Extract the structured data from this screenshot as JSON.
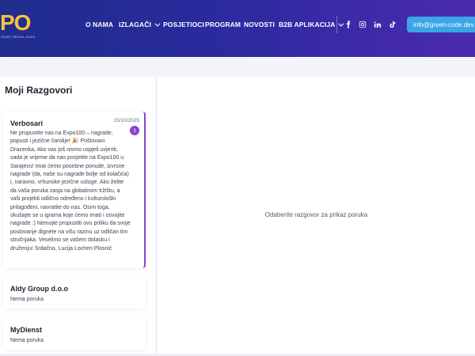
{
  "brand": {
    "logo_text": "PO",
    "logo_sub": "SVIJET, REGIJA, KUĆA"
  },
  "nav": {
    "items": [
      {
        "label": "O NAMA",
        "has_dropdown": false
      },
      {
        "label": "IZLAGAČI",
        "has_dropdown": true
      },
      {
        "label": "POSJETIOCI",
        "has_dropdown": false
      },
      {
        "label": "PROGRAM",
        "has_dropdown": false
      },
      {
        "label": "NOVOSTI",
        "has_dropdown": false
      },
      {
        "label": "B2B APLIKACIJA",
        "has_dropdown": true
      }
    ]
  },
  "social": [
    "facebook-icon",
    "instagram-icon",
    "linkedin-icon",
    "tiktok-icon"
  ],
  "user": {
    "email": "info@green-code.dev"
  },
  "left_panel": {
    "title": "Moji Razgovori",
    "conversations": [
      {
        "name": "Verbosari",
        "date": "15/10/2025",
        "unread": "2",
        "message": "Ne propustite nas na Expo100 – nagrade, popusti i jezične čarolije! 🎉 Poštovani Drazenka, Ako vas još nismo uspjeli uvjeriti, sada je vrijeme da nas posjetite na Expo100 u Sarajevu! Imat ćemo posebne ponude, izvrsne nagrade (da, naše su nagrade bolje od kolačića) i, naravno, vrhunske jezične usluge. Ako želite da vaša poruka zasja na globalnom tržištu, a vaši projekti odlično određeno i kulturološki prilagođeni, navratite do nas. Osim toga, okušajte se u igrama koje ćemo imati i osvojite nagrade :) Nemojte propustiti ovu priliku da svoje poslovanje dignete na višu razinu uz odličan tim stručnjaka. Veselimo se vašem dolasku i druženju! Srdačno, Lucija Lochen Plosnić"
      },
      {
        "name": "Aldy Group d.o.o",
        "subtitle": "Nema poruka"
      },
      {
        "name": "MyDienst",
        "subtitle": "Nema poruka"
      }
    ]
  },
  "right_panel": {
    "empty_text": "Odaberite razgovor za prikaz poruka"
  },
  "colors": {
    "accent": "#8a3fd6",
    "button": "#3ba5e6",
    "header_start": "#1f2d8c",
    "header_end": "#4a2bb0",
    "logo": "#f6c23e"
  }
}
